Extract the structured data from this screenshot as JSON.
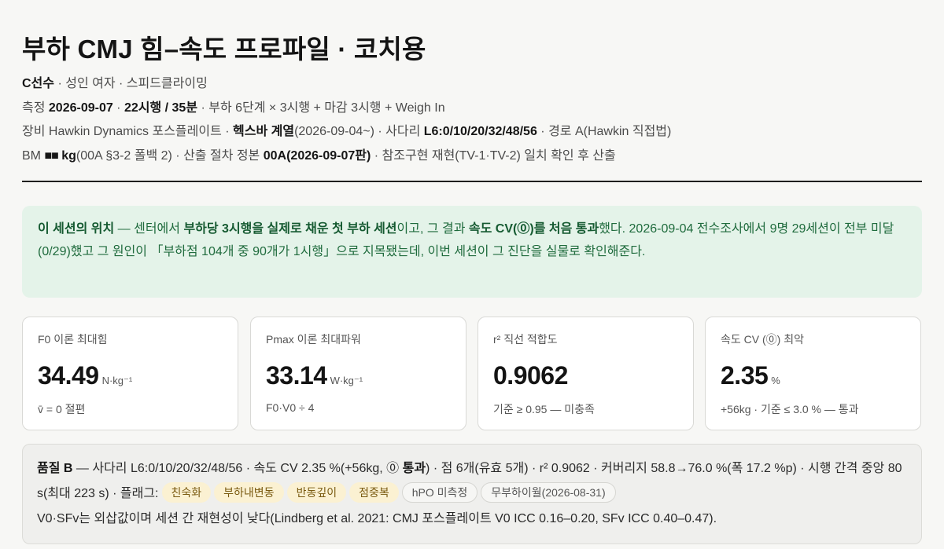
{
  "title": "부하 CMJ 힘–속도 프로파일 · 코치용",
  "meta": {
    "athlete": "C선수",
    "athlete_desc": " · 성인 여자 · 스피드클라이밍",
    "measure_label": "측정 ",
    "date": "2026-09-07",
    "sep1": " · ",
    "trials": "22시행 / 35분",
    "protocol": " · 부하 6단계 × 3시행 + 마감 3시행 + Weigh In",
    "equip_label": "장비 Hawkin Dynamics 포스플레이트 · ",
    "hexbar": "헥스바 계열",
    "hexbar_date": "(2026-09-04~) · 사다리 ",
    "ladder": "L6:0/10/20/32/48/56",
    "route": " · 경로 A(Hawkin 직접법)",
    "bm_label": "BM ",
    "bm_mask": "■■",
    "bm_unit": " kg",
    "bm_src": "(00A §3-2 폴백 2) · 산출 절차 정본 ",
    "proc": "00A(2026-09-07판)",
    "proc_note": " · 참조구현 재현(TV-1·TV-2) 일치 확인 후 산출"
  },
  "callout": {
    "lead": "이 세션의 위치",
    "t1": " — 센터에서 ",
    "b1": "부하당 3시행을 실제로 채운 첫 부하 세션",
    "t2": "이고, 그 결과 ",
    "b2": "속도 CV(⓪)를 처음 통과",
    "t3": "했다. 2026-09-04 전수조사에서 9명 29세션이 전부 미달(0/29)했고 그 원인이 「부하점 104개 중 90개가 1시행」으로 지목됐는데, 이번 세션이 그 진단을 실물로 확인해준다."
  },
  "cards": [
    {
      "label": "F0 이론 최대힘",
      "value": "34.49",
      "unit": "N·kg⁻¹",
      "note": "v̄ = 0 절편"
    },
    {
      "label": "Pmax 이론 최대파워",
      "value": "33.14",
      "unit": "W·kg⁻¹",
      "note": "F0·V0 ÷ 4"
    },
    {
      "label": "r² 직선 적합도",
      "value": "0.9062",
      "unit": "",
      "note": "기준 ≥ 0.95 — 미충족"
    },
    {
      "label": "속도 CV (⓪) 최악",
      "value": "2.35",
      "unit": "%",
      "note": "+56kg · 기준 ≤ 3.0 % — 통과"
    }
  ],
  "quality": {
    "grade": "품질 B",
    "t1": " — 사다리 L6:0/10/20/32/48/56 · 속도 CV 2.35 %(+56kg, ⓪ ",
    "pass": "통과",
    "t2": ") · 점 6개(유효 5개) · r² 0.9062 · 커버리지 58.8→76.0 %(폭 17.2 %p) · 시행 간격 중앙 80 s(최대 223 s) · 플래그:",
    "flags_warn": [
      "친숙화",
      "부하내변동",
      "반동깊이",
      "점중복"
    ],
    "flags_info": [
      "hPO 미측정",
      "무부하이월(2026-08-31)"
    ],
    "footnote": "V0·SFv는 외삽값이며 세션 간 재현성이 낮다(Lindberg et al. 2021: CMJ 포스플레이트 V0 ICC 0.16–0.20, SFv ICC 0.40–0.47)."
  },
  "colors": {
    "callout_bg": "#e4f3e9",
    "callout_text": "#1f6b3d",
    "flag_warn_bg": "#fbf1d2"
  }
}
